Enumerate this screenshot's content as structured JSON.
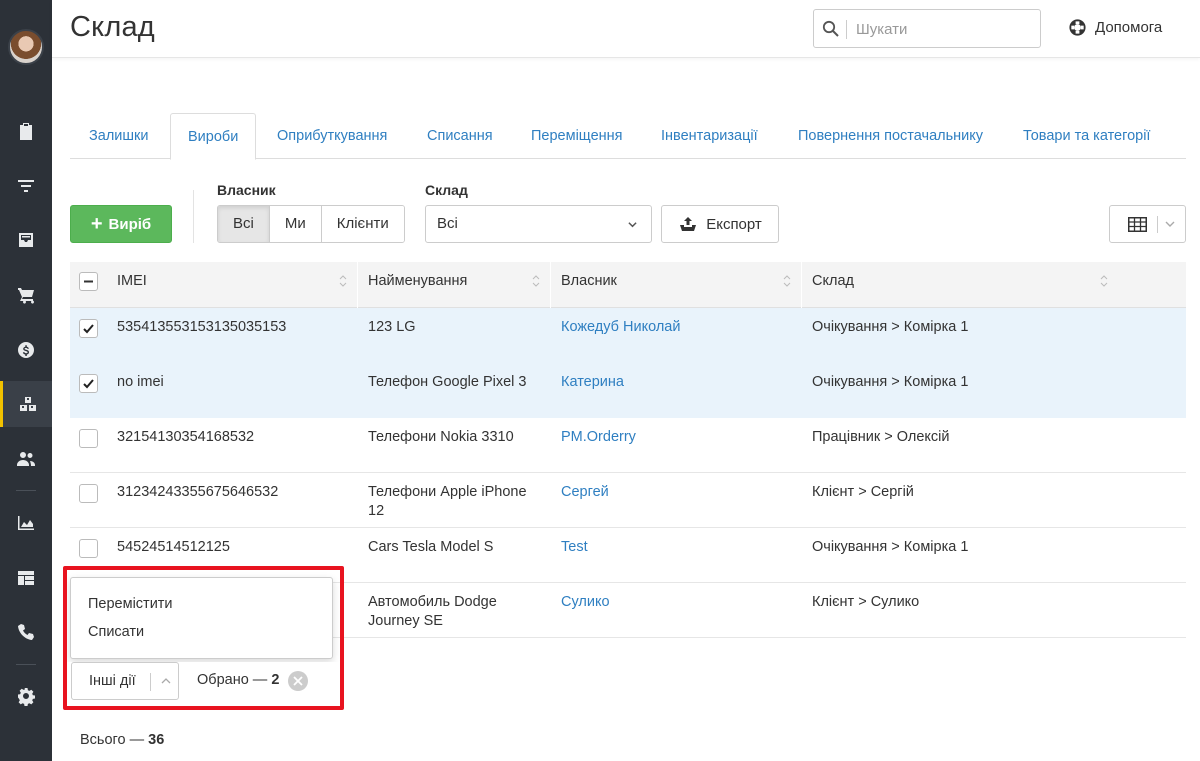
{
  "header": {
    "title": "Склад",
    "search_placeholder": "Шукати",
    "help_label": "Допомога"
  },
  "sidebar": {
    "items": [
      {
        "icon": "clipboard-check-icon"
      },
      {
        "icon": "funnel-icon"
      },
      {
        "icon": "inbox-icon"
      },
      {
        "icon": "cart-icon"
      },
      {
        "icon": "dollar-coin-icon"
      },
      {
        "icon": "boxes-icon",
        "active": true
      },
      {
        "icon": "users-icon"
      },
      {
        "icon": "area-chart-icon"
      },
      {
        "icon": "layout-icon"
      },
      {
        "icon": "phone-icon"
      },
      {
        "icon": "gear-icon"
      }
    ],
    "accent": "#f2c200"
  },
  "tabs": [
    {
      "label": "Залишки"
    },
    {
      "label": "Вироби",
      "active": true
    },
    {
      "label": "Оприбуткування"
    },
    {
      "label": "Списання"
    },
    {
      "label": "Переміщення"
    },
    {
      "label": "Інвентаризації"
    },
    {
      "label": "Повернення постачальнику"
    },
    {
      "label": "Товари та категорії"
    }
  ],
  "filters": {
    "add_label": "Виріб",
    "owner_label": "Власник",
    "owner_options": [
      "Всі",
      "Ми",
      "Клієнти"
    ],
    "owner_selected": "Всі",
    "warehouse_label": "Склад",
    "warehouse_value": "Всі",
    "export_label": "Експорт"
  },
  "table": {
    "columns": [
      "IMEI",
      "Найменування",
      "Власник",
      "Склад"
    ],
    "rows": [
      {
        "checked": true,
        "imei": "535413553153135035153",
        "name": "123 LG",
        "name2": "",
        "owner": "Кожедуб Николай",
        "warehouse": "Очікування > Комірка 1"
      },
      {
        "checked": true,
        "imei": "no imei",
        "name": "Телефон Google Pixel 3",
        "name2": "",
        "owner": "Катерина",
        "warehouse": "Очікування > Комірка 1"
      },
      {
        "checked": false,
        "imei": "32154130354168532",
        "name": "Телефони Nokia 3310",
        "name2": "",
        "owner": "PM.Orderry",
        "warehouse": "Працівник > Олексій"
      },
      {
        "checked": false,
        "imei": "31234243355675646532",
        "name": "Телефони Apple iPhone",
        "name2": "12",
        "owner": "Сергей",
        "warehouse": "Клієнт > Сергій"
      },
      {
        "checked": false,
        "imei": "54524514512125",
        "name": "Cars Tesla Model S",
        "name2": "",
        "owner": "Test",
        "warehouse": "Очікування > Комірка 1"
      },
      {
        "checked": false,
        "imei": "",
        "name": "Автомобиль Dodge",
        "name2": "Journey SE",
        "owner": "Сулико",
        "warehouse": "Клієнт > Сулико"
      }
    ]
  },
  "bulk_actions": {
    "menu_items": [
      "Перемістити",
      "Списати"
    ],
    "other_actions_label": "Інші дії",
    "selected_prefix": "Обрано — ",
    "selected_count": "2",
    "highlight_color": "#e8131f"
  },
  "footer": {
    "total_prefix": "Всього — ",
    "total_count": "36"
  }
}
